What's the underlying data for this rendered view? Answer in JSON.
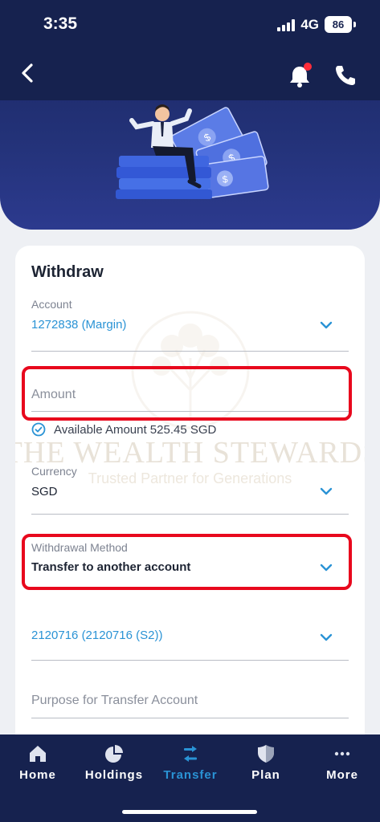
{
  "status_bar": {
    "time": "3:35",
    "network": "4G",
    "battery": "86"
  },
  "header": {
    "hero_icon": "person-on-money-illustration"
  },
  "watermark": {
    "brand": "THE WEALTH STEWARDS",
    "tagline": "Trusted Partner for Generations"
  },
  "form": {
    "title": "Withdraw",
    "account": {
      "label": "Account",
      "value": "1272838 (Margin)"
    },
    "amount": {
      "placeholder": "Amount"
    },
    "available_text": "Available Amount 525.45 SGD",
    "currency": {
      "label": "Currency",
      "value": "SGD"
    },
    "withdrawal_method": {
      "label": "Withdrawal Method",
      "value": "Transfer to another account"
    },
    "target_account": {
      "value": "2120716 (2120716 (S2))"
    },
    "purpose": {
      "placeholder": "Purpose for Transfer Account"
    }
  },
  "nav": {
    "items": [
      {
        "label": "Home",
        "icon": "home-icon"
      },
      {
        "label": "Holdings",
        "icon": "pie-chart-icon"
      },
      {
        "label": "Transfer",
        "icon": "transfer-icon",
        "active": true
      },
      {
        "label": "Plan",
        "icon": "shield-icon"
      },
      {
        "label": "More",
        "icon": "more-dots-icon"
      }
    ]
  },
  "colors": {
    "accent": "#2a93d5",
    "highlight": "#e8081d",
    "navy": "#16224f"
  }
}
